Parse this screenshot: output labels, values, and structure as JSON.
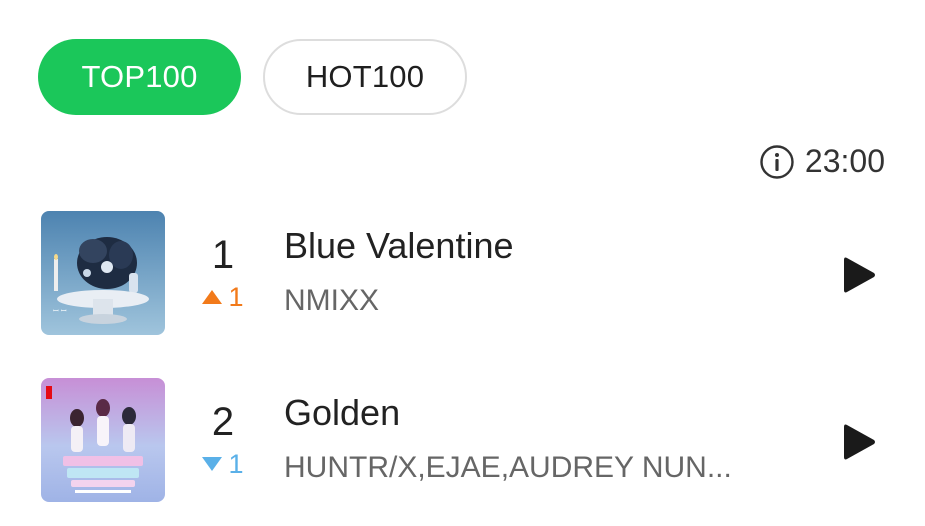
{
  "tabs": [
    {
      "label": "TOP100",
      "active": true
    },
    {
      "label": "HOT100",
      "active": false
    }
  ],
  "update_time": "23:00",
  "icons": {
    "info": "info-icon",
    "play": "play-icon",
    "rank_up": "triangle-up-icon",
    "rank_down": "triangle-down-icon"
  },
  "colors": {
    "accent": "#1bc75a",
    "rank_up": "#f27a1a",
    "rank_down": "#5ab0e8"
  },
  "chart": [
    {
      "rank": "1",
      "change_direction": "up",
      "change": "1",
      "title": "Blue Valentine",
      "artist": "NMIXX"
    },
    {
      "rank": "2",
      "change_direction": "down",
      "change": "1",
      "title": "Golden",
      "artist": "HUNTR/X,EJAE,AUDREY NUN..."
    }
  ]
}
